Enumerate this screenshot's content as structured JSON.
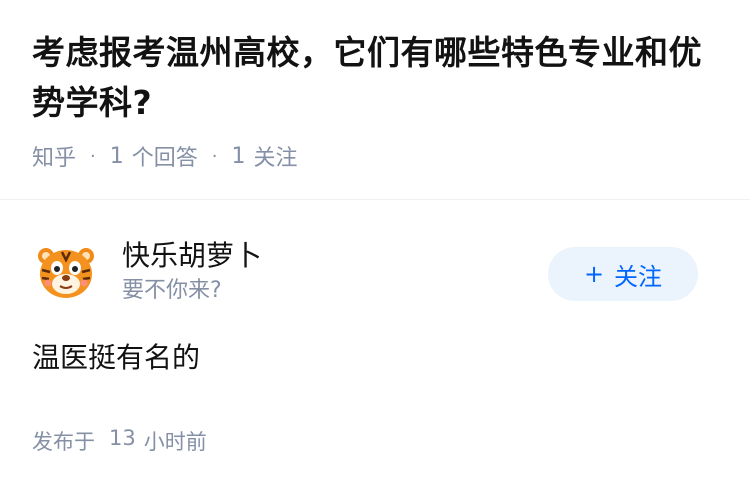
{
  "question": {
    "title": "考虑报考温州高校，它们有哪些特色专业和优势学科?",
    "source": "知乎",
    "answers_count": "1",
    "answers_label": "个回答",
    "followers_count": "1",
    "followers_label": "关注"
  },
  "answer": {
    "author_name": "快乐胡萝卜",
    "author_bio": "要不你来?",
    "follow_label": "关注",
    "follow_icon": "plus-icon",
    "avatar_icon": "tiger-avatar",
    "content": "温医挺有名的",
    "time_prefix": "发布于",
    "time_value": "13",
    "time_unit": "小时前"
  },
  "colors": {
    "accent": "#0066ff",
    "follow_bg": "#ebf3fc",
    "meta": "#8590a6",
    "text": "#121212"
  }
}
